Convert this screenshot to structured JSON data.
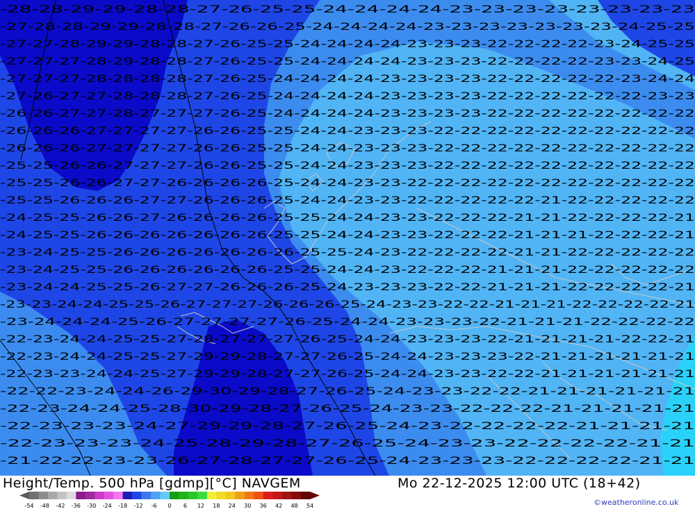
{
  "map": {
    "title": "Height/Temp. 500 hPa [gdmp][°C] NAVGEM",
    "datetime": "Mo 22-12-2025 12:00 UTC (18+42)",
    "credit": "©weatheronline.co.uk",
    "colors": {
      "very_cold": "#0a0ac8",
      "cold": "#1e46e6",
      "mid": "#3c8cf0",
      "mild": "#50b4f5",
      "warm_edge": "#2ad2fa",
      "coastline": "#c8c8c8",
      "contour": "#000000"
    },
    "contour_rows": [
      "-28-28-29-29-28-28-27-26-25-25-24-24-24-24-23-23-23-23-23-23-23-23",
      "-27-28-28-29-29-28-28-27-26-26-25-24-24-24-24-23-23-23-23-23-23-23-24-25-25",
      "-27-27-28-29-29-28-28-27-26-25-25-24-24-24-24-23-23-23-22-22-22-22-23-24-25-25",
      "-27-27-27-28-29-28-28-27-26-25-25-24-24-24-24-23-23-23-22-22-22-22-23-23-24-25",
      "-27-27-27-28-28-28-28-27-26-25-24-24-24-24-23-23-23-23-22-22-22-22-22-23-24-24",
      "-27-26-27-27-28-28-28-27-26-25-24-24-24-24-23-23-23-23-22-22-22-22-22-22-23-23",
      "-26-26-27-27-28-27-27-27-26-25-24-24-24-24-23-23-23-23-22-22-22-22-22-22-22-22",
      "-26-26-26-27-27-27-27-26-26-25-25-24-24-23-23-23-22-22-22-22-22-22-22-22-22-22",
      "-26-26-26-27-27-27-27-26-26-25-25-24-24-23-23-23-22-22-22-22-22-22-22-22-22-22",
      "-25-25-26-26-27-27-27-26-26-25-25-24-24-23-23-23-22-22-22-22-22-22-22-22-22-22",
      "-25-25-26-26-27-27-26-26-26-26-25-24-24-23-23-22-22-22-22-22-22-22-22-22-22-22",
      "-25-25-26-26-26-27-27-26-26-26-25-24-24-23-23-22-22-22-22-22-21-22-22-22-22-22",
      "-24-25-25-26-26-27-26-26-26-26-25-25-24-24-23-23-22-22-22-21-21-22-22-22-22-21",
      "-24-25-25-26-26-26-26-26-26-26-25-25-24-24-23-23-22-22-22-21-21-21-22-22-22-21",
      "-23-24-25-25-26-26-26-26-26-26-26-25-25-24-23-22-22-22-22-21-21-22-22-22-22-22",
      "-23-24-25-25-26-26-26-26-26-26-25-25-24-24-23-22-22-22-21-21-21-22-22-22-22-22",
      "-23-24-24-25-25-26-27-27-26-26-26-25-24-23-23-23-22-22-21-21-21-22-22-22-22-21",
      "-23-23-24-24-25-25-26-27-27-27-26-26-26-25-24-23-23-22-22-21-21-21-22-22-22-22-21",
      "-23-24-24-24-25-26-27-27-27-27-26-25-24-24-23-23-23-22-21-21-21-22-22-22-22",
      "-22-23-24-24-25-25-27-28-27-27-27-26-25-24-24-23-23-23-22-21-21-21-21-22-22-21",
      "-22-23-24-24-25-25-27-29-29-28-27-27-26-25-24-24-23-23-23-22-21-21-21-21-21-21",
      "-22-23-23-24-24-25-27-29-29-28-27-27-26-25-24-24-23-23-22-22-21-21-21-21-21-21",
      "-22-22-23-24-24-26-29-30-29-28-27-26-25-24-23-23-22-22-21-21-21-21-21-21",
      "-22-23-24-24-25-28-30-29-28-27-26-25-24-23-23-22-22-22-21-21-21-21-21",
      "-22-23-23-23-24-27-29-29-28-27-26-25-24-23-22-22-22-22-21-21-21-21",
      "-22-23-23-23-24-25-28-29-28-27-26-25-24-23-23-22-22-22-22-21-21",
      "-21-22-22-23-23-26-27-28-27-27-26-25-24-23-23-23-22-22-22-22-21-21"
    ]
  },
  "legend": {
    "ticks": [
      "-54",
      "-48",
      "-42",
      "-36",
      "-30",
      "-24",
      "-18",
      "-12",
      "-6",
      "0",
      "6",
      "12",
      "18",
      "24",
      "30",
      "36",
      "42",
      "48",
      "54"
    ],
    "colors": [
      "#707070",
      "#8c8c8c",
      "#a8a8a8",
      "#c4c4c4",
      "#dcdcdc",
      "#8c1e8c",
      "#a02aa0",
      "#c83cc8",
      "#e650e6",
      "#f078f0",
      "#1e1eb4",
      "#1e46e6",
      "#3c78f0",
      "#50a0f5",
      "#64c8fa",
      "#14a014",
      "#1eb41e",
      "#28c828",
      "#3cdc3c",
      "#f0f03c",
      "#f0dc28",
      "#f0c81e",
      "#f0a014",
      "#f07814",
      "#f05014",
      "#dc1e1e",
      "#c81414",
      "#a01414",
      "#8c0a0a",
      "#640505"
    ]
  }
}
